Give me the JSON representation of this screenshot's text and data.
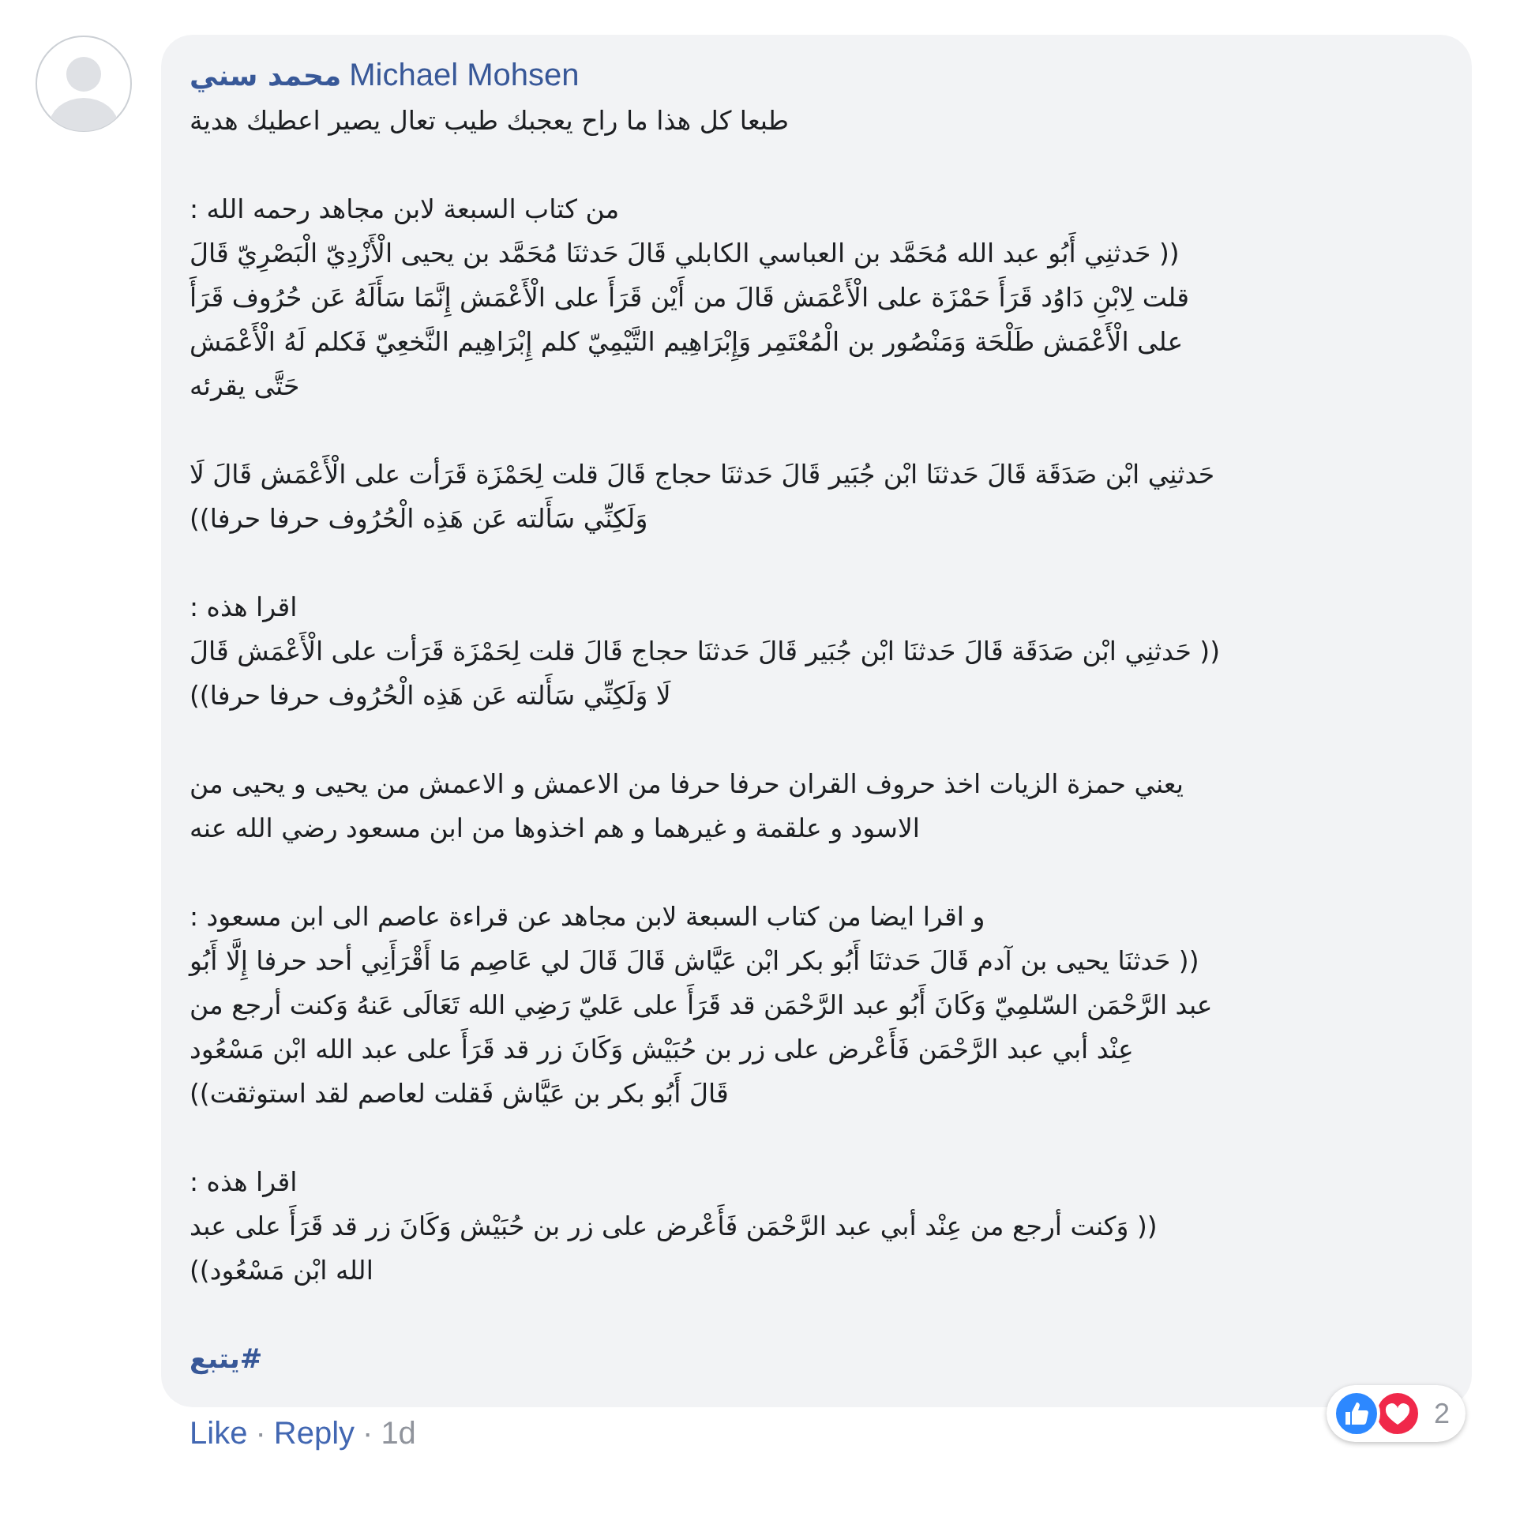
{
  "comment": {
    "author": "محمد سني",
    "mention": "Michael Mohsen",
    "paragraphs": [
      {
        "lines": [
          "طبعا كل هذا ما راح يعجبك طيب تعال يصير اعطيك هدية"
        ]
      },
      {
        "lines": [
          "من كتاب السبعة لابن مجاهد رحمه الله :",
          "(( حَدثنِي أَبُو عبد الله مُحَمَّد بن العباسي الكابلي قَالَ حَدثنَا مُحَمَّد بن يحيى الْأَزْدِيّ الْبَصْرِيّ قَالَ",
          "قلت لِابْنِ دَاوُد قَرَأَ حَمْزَة على الْأَعْمَش قَالَ من أَيْن قَرَأَ على الْأَعْمَش إِنَّمَا سَأَلَهُ عَن حُرُوف قَرَأَ",
          "على الْأَعْمَش طَلْحَة وَمَنْصُور بن الْمُعْتَمِر وَإِبْرَاهِيم التَّيْمِيّ كلم إِبْرَاهِيم النَّخعِيّ فَكلم لَهُ الْأَعْمَش",
          "حَتَّى يقرئه"
        ]
      },
      {
        "lines": [
          "حَدثنِي ابْن صَدَقَة قَالَ حَدثنَا ابْن جُبَير قَالَ حَدثنَا حجاج قَالَ قلت لِحَمْزَة قَرَأت على الْأَعْمَش قَالَ لَا",
          "وَلَكِنِّي سَأَلته عَن هَذِه الْحُرُوف حرفا حرفا))"
        ]
      },
      {
        "lines": [
          "اقرا هذه :",
          "(( حَدثنِي ابْن صَدَقَة قَالَ حَدثنَا ابْن جُبَير قَالَ حَدثنَا حجاج قَالَ قلت لِحَمْزَة قَرَأت على الْأَعْمَش قَالَ",
          "لَا وَلَكِنِّي سَأَلته عَن هَذِه الْحُرُوف حرفا حرفا))"
        ]
      },
      {
        "lines": [
          "يعني حمزة الزيات اخذ حروف القران حرفا حرفا من الاعمش و الاعمش من يحيى و يحيى من",
          "الاسود و علقمة و غيرهما و هم اخذوها من ابن مسعود رضي الله عنه"
        ]
      },
      {
        "lines": [
          "و اقرا ايضا من كتاب السبعة لابن مجاهد عن قراءة عاصم الى ابن مسعود :",
          "(( حَدثنَا يحيى بن آدم قَالَ حَدثنَا أَبُو بكر ابْن عَيَّاش قَالَ قَالَ لي عَاصِم مَا أَقْرَأَنِي أحد حرفا إِلَّا أَبُو",
          "عبد الرَّحْمَن السّلمِيّ وَكَانَ أَبُو عبد الرَّحْمَن قد قَرَأَ على عَليّ رَضِي الله تَعَالَى عَنهُ وَكنت أرجع من",
          "عِنْد أبي عبد الرَّحْمَن فَأَعْرض على زر بن حُبَيْش وَكَانَ زر قد قَرَأَ على عبد الله ابْن مَسْعُود",
          "قَالَ أَبُو بكر بن عَيَّاش فَقلت لعاصم لقد استوثقت))"
        ]
      },
      {
        "lines": [
          "اقرا هذه :",
          "(( وَكنت أرجع من عِنْد أبي عبد الرَّحْمَن فَأَعْرض على زر بن حُبَيْش وَكَانَ زر قد قَرَأَ على عبد",
          "الله ابْن مَسْعُود))"
        ]
      }
    ],
    "hashtag": "#يتبع",
    "like_link": "Like",
    "reply_link": "Reply",
    "separator": "·",
    "time": "1d",
    "reactions": {
      "types": [
        {
          "kind": "like"
        },
        {
          "kind": "love"
        }
      ],
      "count": "2"
    }
  }
}
